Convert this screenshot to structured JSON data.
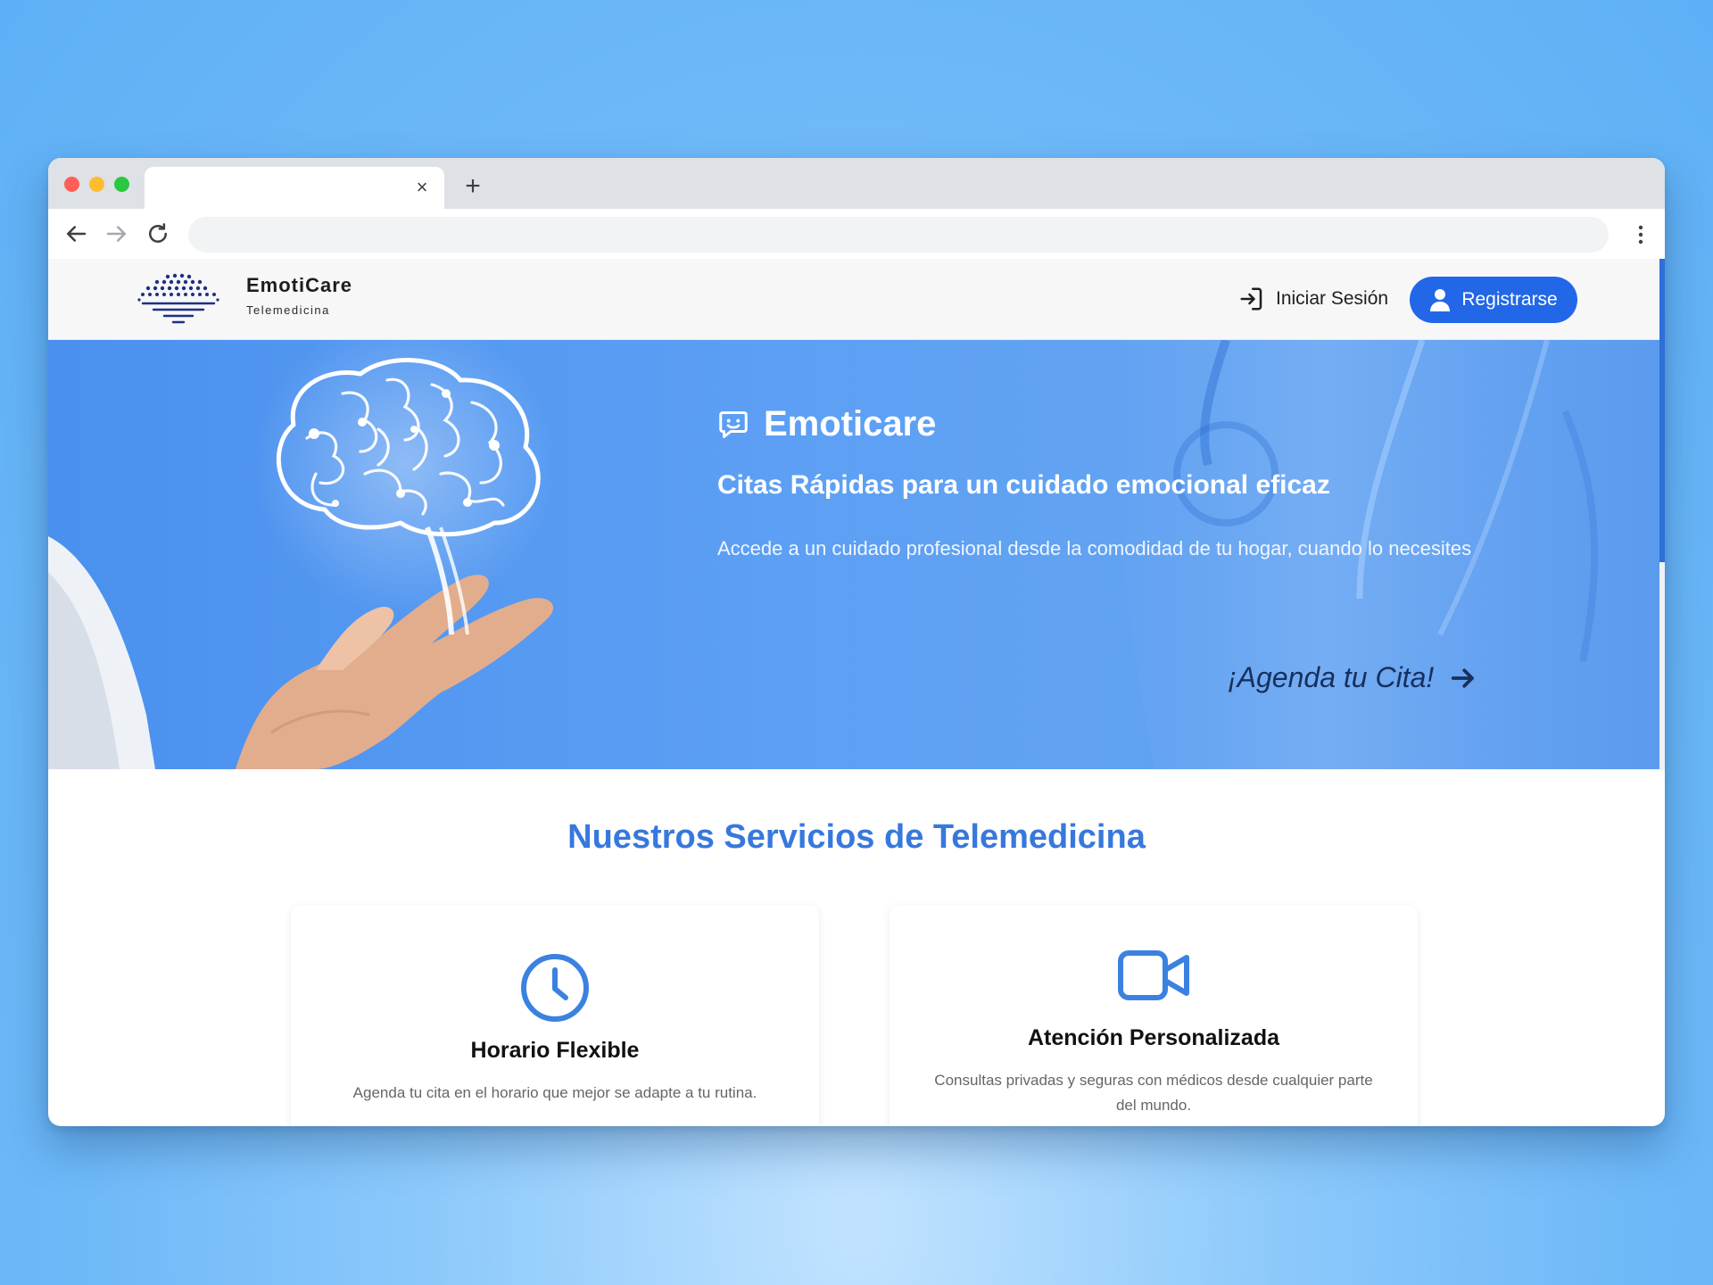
{
  "browser": {
    "tab_title": "",
    "tab_close_glyph": "×",
    "new_tab_glyph": "+",
    "address": ""
  },
  "header": {
    "brand_name": "EmotiCare",
    "brand_tagline": "Telemedicina",
    "login_label": "Iniciar Sesión",
    "register_label": "Registrarse"
  },
  "hero": {
    "title": "Emoticare",
    "subtitle": "Citas Rápidas para un cuidado emocional eficaz",
    "description": "Accede a un cuidado profesional desde la comodidad de tu hogar, cuando lo necesites",
    "cta_label": "¡Agenda tu Cita!"
  },
  "services": {
    "title": "Nuestros Servicios de Telemedicina",
    "cards": [
      {
        "icon": "clock-icon",
        "title": "Horario Flexible",
        "description": "Agenda tu cita en el horario que mejor se adapte a tu rutina."
      },
      {
        "icon": "video-camera-icon",
        "title": "Atención Personalizada",
        "description": "Consultas privadas y seguras con médicos desde cualquier parte del mundo."
      }
    ]
  },
  "colors": {
    "accent": "#2267e8",
    "section_title": "#3778dd",
    "hero_background": "#5c9ff4",
    "cta_text": "#16305e",
    "page_background": "#6db8f8"
  }
}
